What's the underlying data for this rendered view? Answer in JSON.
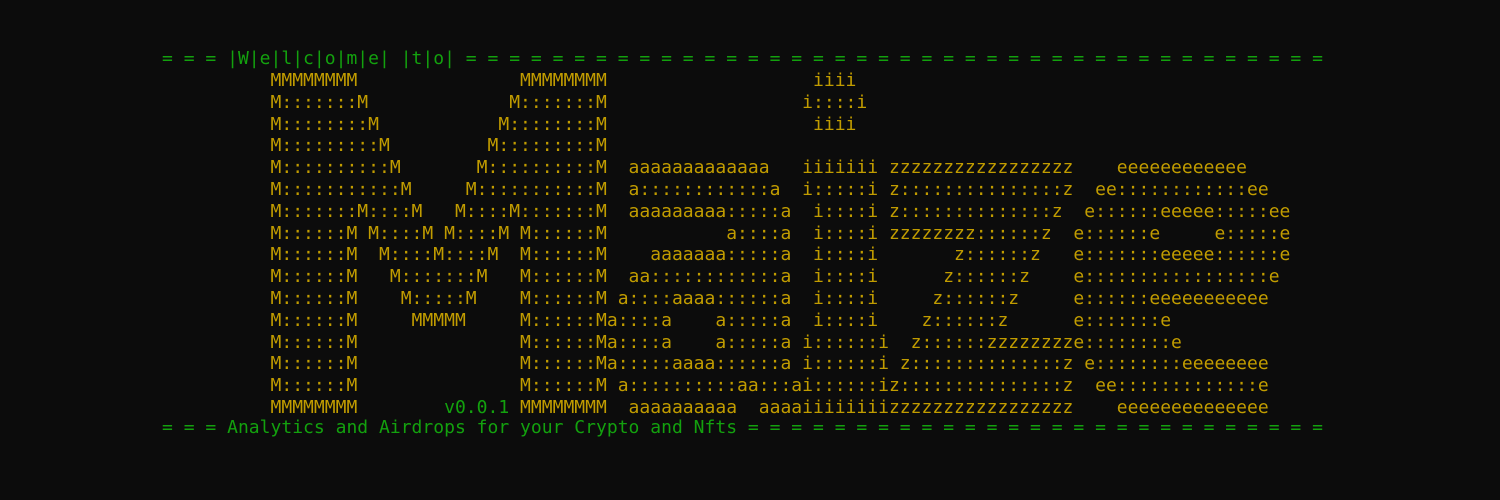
{
  "banner": {
    "top": "= = = |W|e|l|c|o|m|e| |t|o| = = = = = = = = = = = = = = = = = = = = = = = = = = = = = = = = = = = = = = = =",
    "bottom": "= = = Analytics and Airdrops for your Crypto and Nfts = = = = = = = = = = = = = = = = = = = = = = = = = = ="
  },
  "ascii_art": {
    "lines": [
      "          MMMMMMMM               MMMMMMMM                   iiii",
      "          M:::::::M             M:::::::M                  i::::i",
      "          M::::::::M           M::::::::M                   iiii",
      "          M:::::::::M         M:::::::::M",
      "          M::::::::::M       M::::::::::M  aaaaaaaaaaaaa   iiiiiii zzzzzzzzzzzzzzzzz    eeeeeeeeeeee",
      "          M:::::::::::M     M:::::::::::M  a::::::::::::a  i:::::i z:::::::::::::::z  ee::::::::::::ee",
      "          M:::::::M::::M   M::::M:::::::M  aaaaaaaaa:::::a  i::::i z::::::::::::::z  e::::::eeeee:::::ee",
      "          M::::::M M::::M M::::M M::::::M           a::::a  i::::i zzzzzzzz::::::z  e::::::e     e:::::e",
      "          M::::::M  M::::M::::M  M::::::M    aaaaaaa:::::a  i::::i       z::::::z   e:::::::eeeee::::::e",
      "          M::::::M   M:::::::M   M::::::M  aa::::::::::::a  i::::i      z::::::z    e:::::::::::::::::e",
      "          M::::::M    M:::::M    M::::::M a::::aaaa::::::a  i::::i     z::::::z     e::::::eeeeeeeeeee",
      "          M::::::M     MMMMM     M::::::Ma::::a    a:::::a  i::::i    z::::::z      e:::::::e",
      "          M::::::M               M::::::Ma::::a    a:::::a i::::::i  z::::::zzzzzzzze::::::::e",
      "          M::::::M               M::::::Ma:::::aaaa::::::a i::::::i z::::::::::::::z e::::::::eeeeeeee",
      "          M::::::M               M::::::M a::::::::::aa:::ai::::::iz:::::::::::::::z  ee:::::::::::::e",
      "          MMMMMMMM               MMMMMMMM  aaaaaaaaaa  aaaaiiiiiiiizzzzzzzzzzzzzzzzz    eeeeeeeeeeeeee"
    ],
    "version_prefix": "          MMMMMMMM        ",
    "version": "v0.0.1",
    "version_suffix": " MMMMMMMM  aaaaaaaaaa  aaaaiiiiiiiizzzzzzzzzzzzzzzzz    eeeeeeeeeeeeee"
  },
  "colors": {
    "background": "#0c0c0c",
    "green": "#13a10e",
    "yellow": "#c19c00"
  }
}
